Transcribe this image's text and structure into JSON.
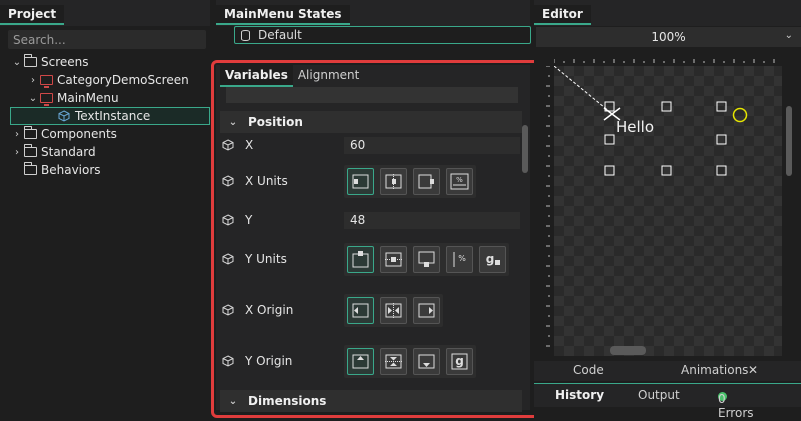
{
  "project": {
    "title": "Project",
    "search_placeholder": "Search...",
    "tree": [
      {
        "label": "Screens",
        "type": "folder",
        "expanded": true
      },
      {
        "label": "CategoryDemoScreen",
        "type": "screen",
        "expanded": false
      },
      {
        "label": "MainMenu",
        "type": "screen",
        "expanded": true
      },
      {
        "label": "TextInstance",
        "type": "instance",
        "selected": true
      },
      {
        "label": "Components",
        "type": "folder",
        "expanded": false
      },
      {
        "label": "Standard",
        "type": "folder",
        "expanded": false
      },
      {
        "label": "Behaviors",
        "type": "folder",
        "expanded": null
      }
    ]
  },
  "states": {
    "title": "MainMenu States",
    "selected_state": "Default"
  },
  "properties": {
    "tabs": [
      {
        "label": "Variables",
        "active": true
      },
      {
        "label": "Alignment",
        "active": false
      }
    ],
    "sections": {
      "position": "Position",
      "dimensions": "Dimensions"
    },
    "rows": {
      "x": {
        "label": "X",
        "value": "60"
      },
      "x_units": {
        "label": "X Units"
      },
      "y": {
        "label": "Y",
        "value": "48"
      },
      "y_units": {
        "label": "Y Units"
      },
      "x_origin": {
        "label": "X Origin"
      },
      "y_origin": {
        "label": "Y Origin"
      }
    },
    "highlight_color": "#e03c3c"
  },
  "editor": {
    "title": "Editor",
    "zoom": "100%",
    "canvas_text": "Hello",
    "tabs_top": {
      "code": "Code",
      "animations": "Animations"
    },
    "tabs_bottom": {
      "history": "History",
      "output": "Output",
      "errors": "0 Errors"
    },
    "accent": "#3aa88a",
    "status_color": "#49c26b"
  }
}
